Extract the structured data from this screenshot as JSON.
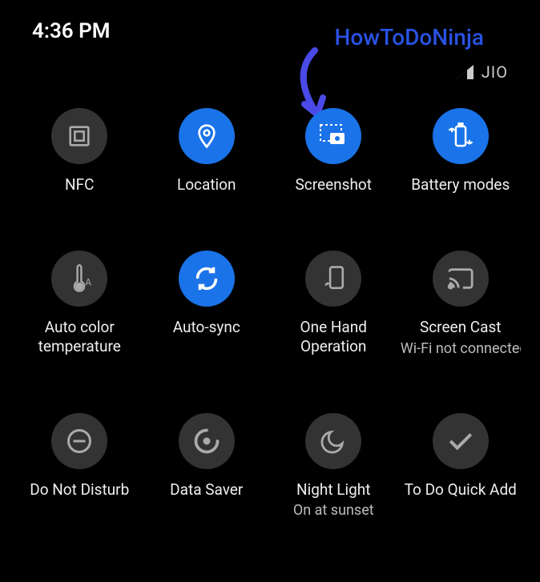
{
  "status": {
    "time": "4:36 PM",
    "carrier": "JIO"
  },
  "watermark": "HowToDoNinja",
  "tiles": [
    {
      "label": "NFC",
      "sublabel": "",
      "active": false
    },
    {
      "label": "Location",
      "sublabel": "",
      "active": true
    },
    {
      "label": "Screenshot",
      "sublabel": "",
      "active": true
    },
    {
      "label": "Battery modes",
      "sublabel": "",
      "active": true
    },
    {
      "label": "Auto color temperature",
      "sublabel": "",
      "active": false
    },
    {
      "label": "Auto-sync",
      "sublabel": "",
      "active": true
    },
    {
      "label": "One Hand Operation",
      "sublabel": "",
      "active": false
    },
    {
      "label": "Screen Cast",
      "sublabel": "Wi-Fi not connected",
      "active": false
    },
    {
      "label": "Do Not Disturb",
      "sublabel": "",
      "active": false
    },
    {
      "label": "Data Saver",
      "sublabel": "",
      "active": false
    },
    {
      "label": "Night Light",
      "sublabel": "On at sunset",
      "active": false
    },
    {
      "label": "To Do Quick Add",
      "sublabel": "",
      "active": false
    }
  ]
}
